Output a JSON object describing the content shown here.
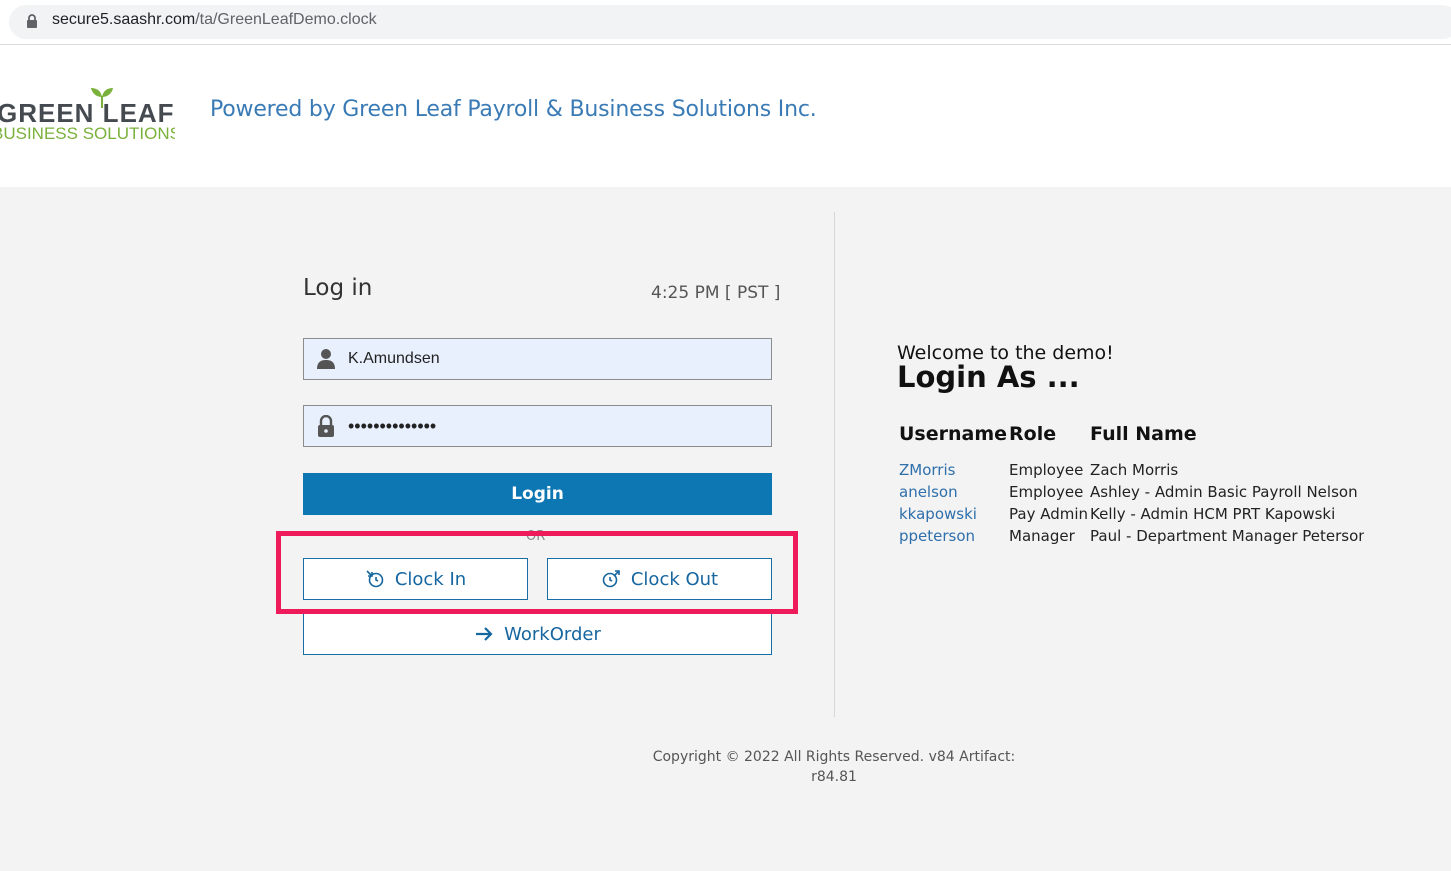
{
  "browser": {
    "url_host": "secure5.saashr.com",
    "url_path": "/ta/GreenLeafDemo.clock"
  },
  "header": {
    "logo_top": "GREEN LEAF",
    "logo_bottom": "BUSINESS SOLUTIONS",
    "powered_by": "Powered by Green Leaf Payroll & Business Solutions Inc."
  },
  "login": {
    "title": "Log in",
    "time": "4:25 PM [ PST ]",
    "username_value": "K.Amundsen",
    "password_value": "••••••••••••••",
    "login_label": "Login",
    "or_label": "OR",
    "clock_in_label": "Clock In",
    "clock_out_label": "Clock Out",
    "workorder_label": "WorkOrder"
  },
  "demo": {
    "welcome": "Welcome to the demo!",
    "login_as": "Login As ...",
    "columns": [
      "Username",
      "Role",
      "Full Name"
    ],
    "rows": [
      {
        "username": "ZMorris",
        "role": "Employee",
        "full_name": "Zach Morris"
      },
      {
        "username": "anelson",
        "role": "Employee",
        "full_name": "Ashley - Admin Basic Payroll Nelson"
      },
      {
        "username": "kkapowski",
        "role": "Pay Admin",
        "full_name": "Kelly - Admin HCM PRT Kapowski"
      },
      {
        "username": "ppeterson",
        "role": "Manager",
        "full_name": "Paul - Department Manager Peterson"
      }
    ]
  },
  "footer": {
    "copyright_line1": "Copyright © 2022 All Rights Reserved. v84 Artifact:",
    "copyright_line2": "r84.81"
  },
  "colors": {
    "login_button": "#0c77b3",
    "highlight_box": "#ee1a5a",
    "link_blue": "#2e6fac",
    "logo_green": "#7ab13b"
  }
}
